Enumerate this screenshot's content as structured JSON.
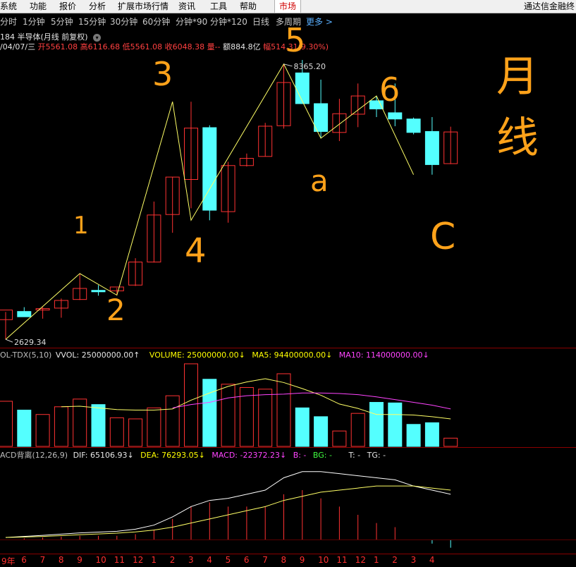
{
  "menubar": {
    "items": [
      "系统",
      "功能",
      "报价",
      "分析",
      "扩展市场行情",
      "资讯",
      "工具",
      "帮助",
      "市场"
    ],
    "active": "市场",
    "right_title": "通达信金融终"
  },
  "periods": {
    "items": [
      "分时",
      "1分钟",
      "5分钟",
      "15分钟",
      "30分钟",
      "60分钟",
      "分钟*90",
      "分钟*120",
      "日线",
      "多周期",
      "更多 >"
    ]
  },
  "chart_title": "184 半导体(月线 前复权)",
  "quote": {
    "date": "/04/07/三",
    "open_label": "开",
    "open": "5561.08",
    "high_label": "高",
    "high": "6116.68",
    "low_label": "低",
    "low": "5561.08",
    "close_label": "收",
    "close": "6048.38",
    "volume_label": "量--",
    "amount_label": "额",
    "amount": "884.8亿",
    "change_label": "幅",
    "change": "514.31(9.30%)"
  },
  "markers": {
    "high": "8365.20",
    "low": "2629.34"
  },
  "vol_header": {
    "name": "OL-TDX(5,10)",
    "vvol": "VVOL: 25000000.00↑",
    "volume": "VOLUME: 25000000.00↓",
    "ma5": "MA5: 94400000.00↓",
    "ma10": "MA10: 114000000.00↓"
  },
  "macd_header": {
    "name": "ACD背离(12,26,9)",
    "dif": "DIF: 65106.93↓",
    "dea": "DEA: 76293.05↓",
    "macd": "MACD: -22372.23↓",
    "b": "B: -",
    "bg": "BG: -",
    "t": "T: -",
    "tg": "TG: -"
  },
  "annotations": [
    "1",
    "2",
    "3",
    "4",
    "5",
    "6",
    "a",
    "C",
    "月线"
  ],
  "x_axis": [
    "9年",
    "6",
    "7",
    "8",
    "9",
    "10",
    "11",
    "12",
    "1",
    "2",
    "3",
    "4",
    "5",
    "6",
    "7",
    "8",
    "9",
    "10",
    "11",
    "12",
    "1",
    "2",
    "3",
    "4"
  ],
  "colors": {
    "up": "#ff3232",
    "down": "#54ffff",
    "wave": "#ffff66",
    "hand": "#ffa21a"
  },
  "chart_data": {
    "type": "candlestick",
    "title": "184 半导体(月线 前复权)",
    "ylim": [
      2500,
      8700
    ],
    "candles": [
      {
        "o": 3040,
        "h": 3200,
        "l": 2629,
        "c": 3240
      },
      {
        "o": 3210,
        "h": 3300,
        "l": 3100,
        "c": 3100
      },
      {
        "o": 3240,
        "h": 3300,
        "l": 3060,
        "c": 3270
      },
      {
        "o": 3280,
        "h": 3480,
        "l": 3080,
        "c": 3440
      },
      {
        "o": 3460,
        "h": 4000,
        "l": 3450,
        "c": 3690
      },
      {
        "o": 3650,
        "h": 3760,
        "l": 3540,
        "c": 3620
      },
      {
        "o": 3640,
        "h": 3700,
        "l": 3550,
        "c": 3720
      },
      {
        "o": 3760,
        "h": 4320,
        "l": 3740,
        "c": 4240
      },
      {
        "o": 4240,
        "h": 5500,
        "l": 4230,
        "c": 5220
      },
      {
        "o": 5230,
        "h": 6010,
        "l": 4850,
        "c": 6010
      },
      {
        "o": 5960,
        "h": 7580,
        "l": 5360,
        "c": 7030
      },
      {
        "o": 7040,
        "h": 7090,
        "l": 5110,
        "c": 5320
      },
      {
        "o": 5290,
        "h": 6330,
        "l": 5060,
        "c": 6250
      },
      {
        "o": 6250,
        "h": 6500,
        "l": 6230,
        "c": 6400
      },
      {
        "o": 6440,
        "h": 7140,
        "l": 6440,
        "c": 7070
      },
      {
        "o": 7080,
        "h": 8365,
        "l": 7020,
        "c": 7980
      },
      {
        "o": 8180,
        "h": 8450,
        "l": 7560,
        "c": 7540
      },
      {
        "o": 7540,
        "h": 8040,
        "l": 6820,
        "c": 6960
      },
      {
        "o": 6940,
        "h": 7640,
        "l": 6760,
        "c": 7330
      },
      {
        "o": 7320,
        "h": 7960,
        "l": 7050,
        "c": 7700
      },
      {
        "o": 7600,
        "h": 7700,
        "l": 7260,
        "c": 7430
      },
      {
        "o": 7350,
        "h": 7960,
        "l": 7070,
        "c": 7220
      },
      {
        "o": 7220,
        "h": 7250,
        "l": 6900,
        "c": 6940
      },
      {
        "o": 6960,
        "h": 7260,
        "l": 6060,
        "c": 6270
      },
      {
        "o": 6290,
        "h": 7060,
        "l": 6280,
        "c": 6950
      }
    ],
    "wave_points": [
      [
        0,
        2629
      ],
      [
        4,
        4000
      ],
      [
        6,
        3550
      ],
      [
        9,
        7580
      ],
      [
        10,
        5110
      ],
      [
        15,
        8365
      ],
      [
        17,
        6820
      ],
      [
        20,
        7700
      ],
      [
        22,
        6060
      ]
    ],
    "volume": {
      "values": [
        82,
        66,
        58,
        72,
        86,
        76,
        52,
        50,
        70,
        92,
        150,
        122,
        113,
        107,
        104,
        132,
        70,
        54,
        28,
        60,
        80,
        79,
        40,
        43,
        15
      ],
      "ma5": [
        null,
        null,
        null,
        72,
        73,
        70,
        67,
        66,
        66,
        68,
        84,
        97,
        109,
        117,
        123,
        116,
        105,
        93,
        77,
        69,
        58,
        58,
        57,
        54,
        50
      ],
      "ma10": [
        null,
        null,
        null,
        null,
        null,
        null,
        null,
        null,
        null,
        70,
        76,
        80,
        88,
        92,
        94,
        95,
        97,
        97,
        96,
        94,
        90,
        85,
        80,
        75,
        68
      ]
    },
    "macd": {
      "dif": [
        1,
        1.5,
        2,
        2.6,
        3.2,
        3.6,
        4,
        5,
        7,
        11,
        16,
        19,
        20,
        22,
        24,
        30,
        33,
        33,
        32,
        31,
        30,
        29,
        26,
        24,
        22
      ],
      "dea": [
        1,
        1.2,
        1.5,
        1.9,
        2.3,
        2.7,
        3.1,
        3.7,
        4.6,
        6,
        8,
        10,
        12,
        14,
        16,
        19,
        21,
        23,
        24,
        25,
        26,
        26,
        26,
        25,
        24
      ],
      "hist": [
        0,
        0.6,
        1,
        1.4,
        1.8,
        1.8,
        1.8,
        2.6,
        4.8,
        10,
        16,
        18,
        16,
        16,
        16,
        22,
        24,
        20,
        16,
        12,
        8,
        6,
        0,
        -2,
        -4
      ]
    }
  }
}
